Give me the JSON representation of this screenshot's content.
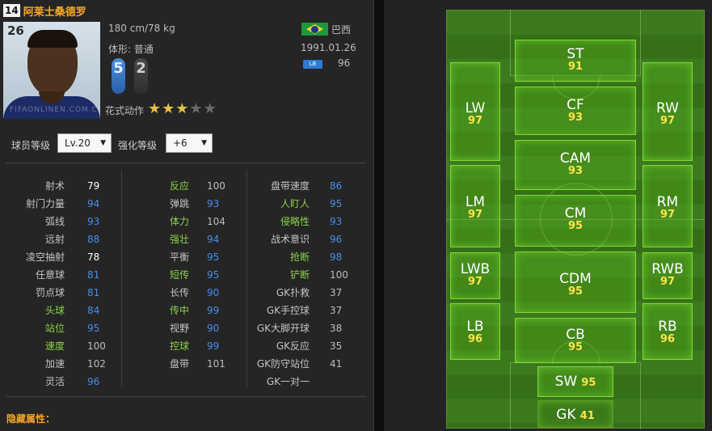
{
  "player": {
    "number": "14",
    "name": "阿莱士桑德罗",
    "overall": "26",
    "height_weight": "180 cm/78 kg",
    "body_type": "体形: 普通",
    "nation": "巴西",
    "birthdate": "1991.01.26",
    "position_badge": "LB",
    "position_rating": "96",
    "left_foot": "5",
    "right_foot": "2",
    "skill_moves_label": "花式动作",
    "skill_stars": 3,
    "skill_stars_max": 5,
    "watermark": "FIFAONLINEN.COM.CN",
    "flag_colors": [
      "#1c9a3a",
      "#f3d22b",
      "#23348a"
    ]
  },
  "controls": {
    "level_label": "球员等级",
    "level_value": "Lv.20",
    "enhance_label": "强化等级",
    "enhance_value": "+6"
  },
  "stats": {
    "col1": [
      {
        "label": "射术",
        "value": "79",
        "label_color": "gray",
        "value_color": "white"
      },
      {
        "label": "射门力量",
        "value": "94",
        "label_color": "gray",
        "value_color": "blue"
      },
      {
        "label": "弧线",
        "value": "93",
        "label_color": "gray",
        "value_color": "blue"
      },
      {
        "label": "远射",
        "value": "88",
        "label_color": "gray",
        "value_color": "blue"
      },
      {
        "label": "凌空抽射",
        "value": "78",
        "label_color": "gray",
        "value_color": "white"
      },
      {
        "label": "任意球",
        "value": "81",
        "label_color": "gray",
        "value_color": "blue"
      },
      {
        "label": "罚点球",
        "value": "81",
        "label_color": "gray",
        "value_color": "blue"
      },
      {
        "label": "头球",
        "value": "84",
        "label_color": "green",
        "value_color": "blue"
      },
      {
        "label": "站位",
        "value": "95",
        "label_color": "green",
        "value_color": "blue"
      },
      {
        "label": "速度",
        "value": "100",
        "label_color": "green",
        "value_color": "gray"
      },
      {
        "label": "加速",
        "value": "102",
        "label_color": "gray",
        "value_color": "gray"
      },
      {
        "label": "灵活",
        "value": "96",
        "label_color": "gray",
        "value_color": "blue"
      }
    ],
    "col2": [
      {
        "label": "反应",
        "value": "100",
        "label_color": "green",
        "value_color": "gray"
      },
      {
        "label": "弹跳",
        "value": "93",
        "label_color": "gray",
        "value_color": "blue"
      },
      {
        "label": "体力",
        "value": "104",
        "label_color": "green",
        "value_color": "gray"
      },
      {
        "label": "强壮",
        "value": "94",
        "label_color": "green",
        "value_color": "blue"
      },
      {
        "label": "平衡",
        "value": "95",
        "label_color": "gray",
        "value_color": "blue"
      },
      {
        "label": "短传",
        "value": "95",
        "label_color": "green",
        "value_color": "blue"
      },
      {
        "label": "长传",
        "value": "90",
        "label_color": "gray",
        "value_color": "blue"
      },
      {
        "label": "传中",
        "value": "99",
        "label_color": "green",
        "value_color": "blue"
      },
      {
        "label": "视野",
        "value": "90",
        "label_color": "gray",
        "value_color": "blue"
      },
      {
        "label": "控球",
        "value": "99",
        "label_color": "green",
        "value_color": "blue"
      },
      {
        "label": "盘带",
        "value": "101",
        "label_color": "gray",
        "value_color": "gray"
      }
    ],
    "col3": [
      {
        "label": "盘带速度",
        "value": "86",
        "label_color": "gray",
        "value_color": "blue"
      },
      {
        "label": "人盯人",
        "value": "95",
        "label_color": "green",
        "value_color": "blue"
      },
      {
        "label": "侵略性",
        "value": "93",
        "label_color": "green",
        "value_color": "blue"
      },
      {
        "label": "战术意识",
        "value": "96",
        "label_color": "gray",
        "value_color": "blue"
      },
      {
        "label": "抢断",
        "value": "98",
        "label_color": "green",
        "value_color": "blue"
      },
      {
        "label": "铲断",
        "value": "100",
        "label_color": "green",
        "value_color": "gray"
      },
      {
        "label": "GK扑救",
        "value": "37",
        "label_color": "gray",
        "value_color": "gray"
      },
      {
        "label": "GK手控球",
        "value": "37",
        "label_color": "gray",
        "value_color": "gray"
      },
      {
        "label": "GK大脚开球",
        "value": "38",
        "label_color": "gray",
        "value_color": "gray"
      },
      {
        "label": "GK反应",
        "value": "35",
        "label_color": "gray",
        "value_color": "gray"
      },
      {
        "label": "GK防守站位",
        "value": "41",
        "label_color": "gray",
        "value_color": "gray"
      },
      {
        "label": "GK一对一",
        "value": "",
        "label_color": "gray",
        "value_color": "gray"
      }
    ]
  },
  "hidden_attributes_label": "隐藏属性：",
  "pitch": {
    "positions": {
      "st": {
        "name": "ST",
        "rating": "91"
      },
      "lw": {
        "name": "LW",
        "rating": "97"
      },
      "cf": {
        "name": "CF",
        "rating": "93"
      },
      "rw": {
        "name": "RW",
        "rating": "97"
      },
      "cam": {
        "name": "CAM",
        "rating": "93"
      },
      "lm": {
        "name": "LM",
        "rating": "97"
      },
      "cm": {
        "name": "CM",
        "rating": "95"
      },
      "rm": {
        "name": "RM",
        "rating": "97"
      },
      "lwb": {
        "name": "LWB",
        "rating": "97"
      },
      "cdm": {
        "name": "CDM",
        "rating": "95"
      },
      "rwb": {
        "name": "RWB",
        "rating": "97"
      },
      "lb": {
        "name": "LB",
        "rating": "96"
      },
      "cb": {
        "name": "CB",
        "rating": "95"
      },
      "rb": {
        "name": "RB",
        "rating": "96"
      },
      "sw": {
        "name": "SW",
        "rating": "95"
      },
      "gk": {
        "name": "GK",
        "rating": "41"
      }
    }
  }
}
